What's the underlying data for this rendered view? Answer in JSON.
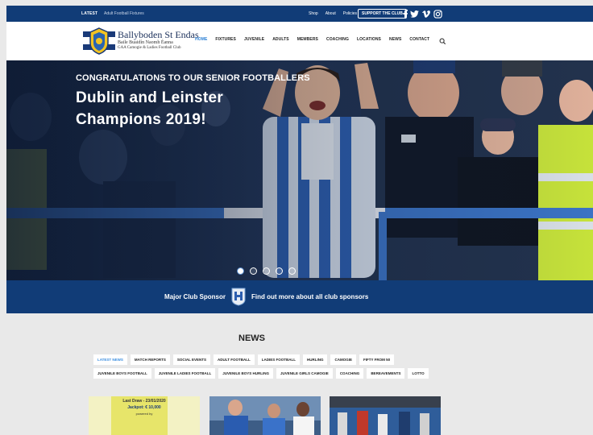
{
  "topbar": {
    "latest_label": "LATEST",
    "latest_text": "Adult Football Fixtures",
    "links": [
      "Shop",
      "About",
      "Policies"
    ],
    "support_label": "SUPPORT THE CLUB",
    "social_icons": [
      "facebook-icon",
      "twitter-icon",
      "vimeo-icon",
      "instagram-icon"
    ]
  },
  "brand": {
    "name": "Ballyboden St Endas",
    "irish": "Baile Buaidín Naomh Éanna",
    "sub": "GAA Camogie & Ladies Football Club"
  },
  "nav": [
    "HOME",
    "FIXTURES",
    "JUVENILE",
    "ADULTS",
    "MEMBERS",
    "COACHING",
    "LOCATIONS",
    "NEWS",
    "CONTACT"
  ],
  "nav_active": "HOME",
  "hero": {
    "kicker": "CONGRATULATIONS TO OUR SENIOR FOOTBALLERS",
    "title_line1": "Dublin and Leinster",
    "title_line2": "Champions 2019!",
    "slide_count": 5,
    "active_slide": 1
  },
  "sponsor": {
    "label": "Major Club Sponsor",
    "link": "Find out more about all club sponsors"
  },
  "news": {
    "title": "NEWS",
    "tags": [
      "LATEST NEWS",
      "MATCH REPORTS",
      "SOCIAL EVENTS",
      "ADULT FOOTBALL",
      "LADIES FOOTBALL",
      "HURLING",
      "CAMOGIE",
      "FIFTY FROM 50",
      "JUVENILE BOYS FOOTBALL",
      "JUVENILE LADIES FOOTBALL",
      "JUVENILE BOYS HURLING",
      "JUVENILE GIRLS CAMOGIE",
      "COACHING",
      "BEREAVEMENTS",
      "LOTTO"
    ],
    "active_tag": "LATEST NEWS",
    "card1_top": "Last Draw - 23/01/2020",
    "card1_jackpot": "Jackpot: € 10,000",
    "card1_powered": "powered by"
  },
  "colors": {
    "navy": "#113c77",
    "accent": "#2a7fd4",
    "page_bg": "#e9e9e9"
  }
}
